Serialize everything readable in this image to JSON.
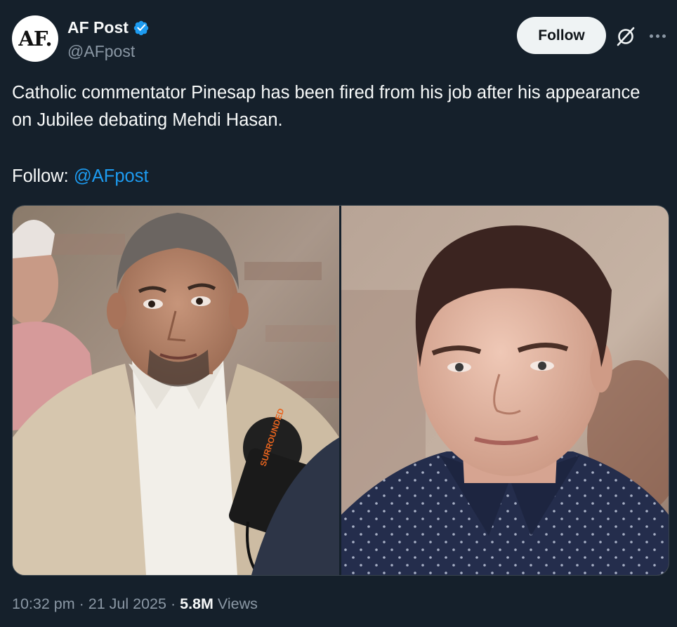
{
  "author": {
    "avatar_text": "AF.",
    "display_name": "AF Post",
    "handle": "@AFpost",
    "verified": true
  },
  "actions": {
    "follow_label": "Follow"
  },
  "tweet": {
    "text": "Catholic commentator Pinesap has been fired from his job after his appearance on Jubilee debating Mehdi Hasan.",
    "follow_prefix": "Follow: ",
    "follow_mention": "@AFpost"
  },
  "media": {
    "left_photo_mic_label": "SURROUNDED",
    "photos": [
      "left-photo-man-in-beige-blazer",
      "right-photo-man-in-dotted-shirt"
    ]
  },
  "meta": {
    "time": "10:32 pm",
    "date": "21 Jul 2025",
    "separator": "·",
    "views_count": "5.8M",
    "views_label": "Views"
  },
  "colors": {
    "background": "#15202b",
    "text": "#f7f9f9",
    "muted": "#8b98a5",
    "link": "#1d9bf0",
    "verified": "#1d9bf0",
    "follow_bg": "#eff3f4"
  },
  "icons": [
    "verified-badge-icon",
    "grok-icon",
    "more-options-icon"
  ]
}
